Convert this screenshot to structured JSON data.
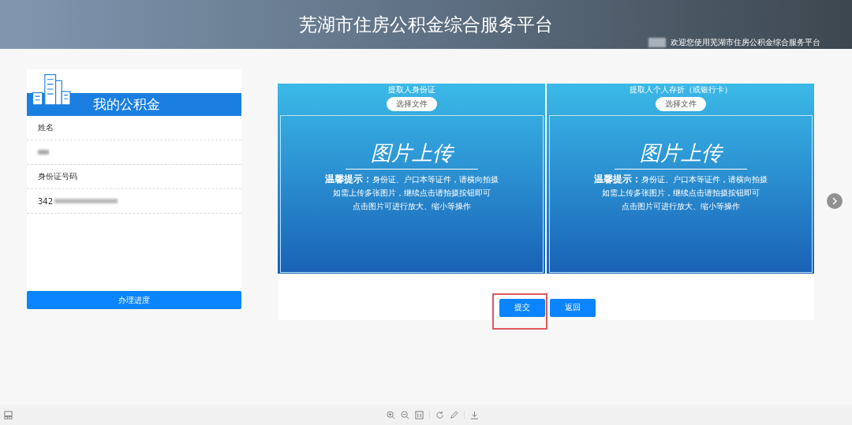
{
  "header": {
    "title": "芜湖市住房公积金综合服务平台",
    "welcome": "欢迎您使用芜湖市住房公积金综合服务平台"
  },
  "profile": {
    "title": "我的公积金",
    "fields": [
      {
        "label": "姓名"
      },
      {
        "label": "身份证号码",
        "value": "342"
      }
    ],
    "button": "办理进度"
  },
  "uploads": [
    {
      "title": "提取人身份证",
      "button": "选择文件",
      "heading": "图片上传",
      "tips": [
        "**温馨提示：**身份证、户口本等证件，请横向拍摄",
        "如需上传多张图片，继续点击请拍摄按钮即可",
        "点击图片可进行放大、缩小等操作"
      ]
    },
    {
      "title": "提取人个人存折（或银行卡）",
      "button": "选择文件",
      "heading": "图片上传",
      "tips": [
        "**温馨提示：**身份证、户口本等证件，请横向拍摄",
        "如需上传多张图片，继续点击请拍摄按钮即可",
        "点击图片可进行放大、缩小等操作"
      ]
    }
  ],
  "actions": [
    {
      "label": "提交",
      "highlighted": true
    },
    {
      "label": "返回",
      "highlighted": false
    }
  ]
}
